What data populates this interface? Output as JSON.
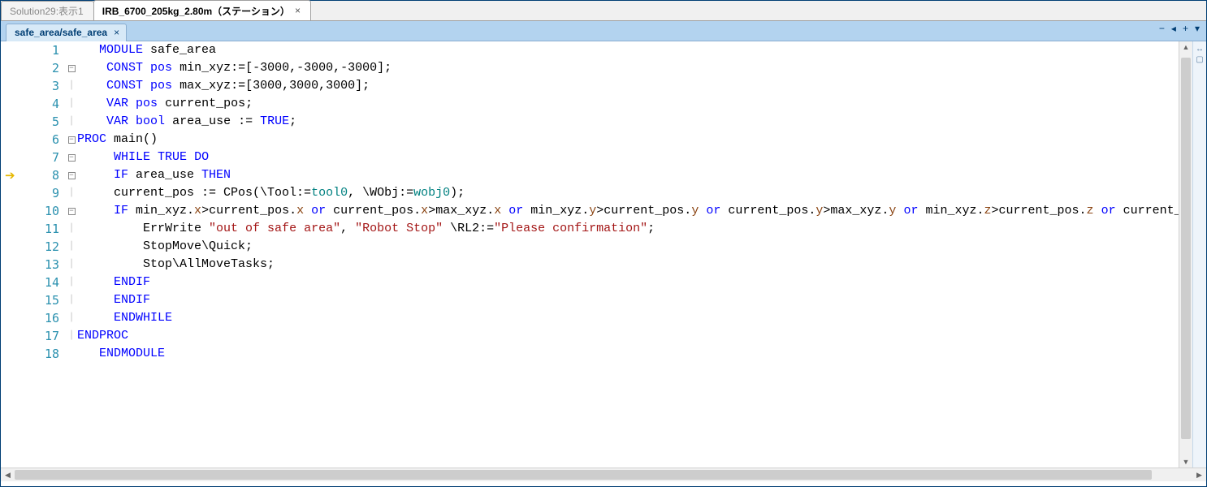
{
  "outerTabs": [
    {
      "label": "Solution29:表示1",
      "active": false,
      "closable": false
    },
    {
      "label": "IRB_6700_205kg_2.80m（ステーション）",
      "active": true,
      "closable": true
    }
  ],
  "innerTab": {
    "label": "safe_area/safe_area",
    "closeGlyph": "×"
  },
  "toolbarIcons": {
    "minimize": "−",
    "zoomOut": "◂",
    "zoomIn": "+",
    "menu": "▾"
  },
  "execArrowLine": 8,
  "code": {
    "lines": [
      {
        "n": 1,
        "fold": "",
        "tokens": [
          [
            "",
            "   "
          ],
          [
            "kw",
            "MODULE"
          ],
          [
            "",
            " safe_area"
          ]
        ]
      },
      {
        "n": 2,
        "fold": "-",
        "tokens": [
          [
            "",
            "    "
          ],
          [
            "kw",
            "CONST"
          ],
          [
            "",
            " "
          ],
          [
            "type",
            "pos"
          ],
          [
            "",
            " min_xyz:=[-3000,-3000,-3000];"
          ]
        ]
      },
      {
        "n": 3,
        "fold": "|",
        "tokens": [
          [
            "",
            "    "
          ],
          [
            "kw",
            "CONST"
          ],
          [
            "",
            " "
          ],
          [
            "type",
            "pos"
          ],
          [
            "",
            " max_xyz:=[3000,3000,3000];"
          ]
        ]
      },
      {
        "n": 4,
        "fold": "|",
        "tokens": [
          [
            "",
            "    "
          ],
          [
            "kw",
            "VAR"
          ],
          [
            "",
            " "
          ],
          [
            "type",
            "pos"
          ],
          [
            "",
            " current_pos;"
          ]
        ]
      },
      {
        "n": 5,
        "fold": "|",
        "tokens": [
          [
            "",
            "    "
          ],
          [
            "kw",
            "VAR"
          ],
          [
            "",
            " "
          ],
          [
            "type",
            "bool"
          ],
          [
            "",
            " area_use := "
          ],
          [
            "kw",
            "TRUE"
          ],
          [
            "",
            ";"
          ]
        ]
      },
      {
        "n": 6,
        "fold": "-",
        "tokens": [
          [
            "kw",
            "PROC"
          ],
          [
            "",
            " main()"
          ]
        ]
      },
      {
        "n": 7,
        "fold": "-",
        "tokens": [
          [
            "",
            "     "
          ],
          [
            "kw",
            "WHILE"
          ],
          [
            "",
            " "
          ],
          [
            "kw",
            "TRUE"
          ],
          [
            "",
            " "
          ],
          [
            "kw",
            "DO"
          ]
        ]
      },
      {
        "n": 8,
        "fold": "-",
        "tokens": [
          [
            "",
            "     "
          ],
          [
            "kw",
            "IF"
          ],
          [
            "",
            " area_use "
          ],
          [
            "kw",
            "THEN"
          ]
        ]
      },
      {
        "n": 9,
        "fold": "|",
        "tokens": [
          [
            "",
            "     current_pos := "
          ],
          [
            "fn",
            "CPos"
          ],
          [
            "",
            "(\\Tool:="
          ],
          [
            "builtin",
            "tool0"
          ],
          [
            "",
            ", \\WObj:="
          ],
          [
            "builtin",
            "wobj0"
          ],
          [
            "",
            ");"
          ]
        ]
      },
      {
        "n": 10,
        "fold": "-",
        "tokens": [
          [
            "",
            "     "
          ],
          [
            "kw",
            "IF"
          ],
          [
            "",
            " min_xyz."
          ],
          [
            "brown",
            "x"
          ],
          [
            "",
            ">current_pos."
          ],
          [
            "brown",
            "x"
          ],
          [
            "",
            " "
          ],
          [
            "kw",
            "or"
          ],
          [
            "",
            " current_pos."
          ],
          [
            "brown",
            "x"
          ],
          [
            "",
            ">max_xyz."
          ],
          [
            "brown",
            "x"
          ],
          [
            "",
            " "
          ],
          [
            "kw",
            "or"
          ],
          [
            "",
            " min_xyz."
          ],
          [
            "brown",
            "y"
          ],
          [
            "",
            ">current_pos."
          ],
          [
            "brown",
            "y"
          ],
          [
            "",
            " "
          ],
          [
            "kw",
            "or"
          ],
          [
            "",
            " current_pos."
          ],
          [
            "brown",
            "y"
          ],
          [
            "",
            ">max_xyz."
          ],
          [
            "brown",
            "y"
          ],
          [
            "",
            " "
          ],
          [
            "kw",
            "or"
          ],
          [
            "",
            " min_xyz."
          ],
          [
            "brown",
            "z"
          ],
          [
            "",
            ">current_pos."
          ],
          [
            "brown",
            "z"
          ],
          [
            "",
            " "
          ],
          [
            "kw",
            "or"
          ],
          [
            "",
            " current_po"
          ]
        ]
      },
      {
        "n": 11,
        "fold": "|",
        "tokens": [
          [
            "",
            "         "
          ],
          [
            "fn",
            "ErrWrite"
          ],
          [
            "",
            " "
          ],
          [
            "str",
            "\"out of safe area\""
          ],
          [
            "",
            ", "
          ],
          [
            "str",
            "\"Robot Stop\""
          ],
          [
            "",
            " \\RL2:="
          ],
          [
            "str",
            "\"Please confirmation\""
          ],
          [
            "",
            ";"
          ]
        ]
      },
      {
        "n": 12,
        "fold": "|",
        "tokens": [
          [
            "",
            "         "
          ],
          [
            "fn",
            "StopMove"
          ],
          [
            "",
            "\\Quick;"
          ]
        ]
      },
      {
        "n": 13,
        "fold": "|",
        "tokens": [
          [
            "",
            "         "
          ],
          [
            "fn",
            "Stop"
          ],
          [
            "",
            "\\AllMoveTasks;"
          ]
        ]
      },
      {
        "n": 14,
        "fold": "|",
        "tokens": [
          [
            "",
            "     "
          ],
          [
            "kw",
            "ENDIF"
          ]
        ]
      },
      {
        "n": 15,
        "fold": "|",
        "tokens": [
          [
            "",
            "     "
          ],
          [
            "kw",
            "ENDIF"
          ]
        ]
      },
      {
        "n": 16,
        "fold": "|",
        "tokens": [
          [
            "",
            "     "
          ],
          [
            "kw",
            "ENDWHILE"
          ]
        ]
      },
      {
        "n": 17,
        "fold": "|",
        "tokens": [
          [
            "kw",
            "ENDPROC"
          ]
        ]
      },
      {
        "n": 18,
        "fold": "",
        "tokens": [
          [
            "",
            "   "
          ],
          [
            "kw",
            "ENDMODULE"
          ]
        ]
      }
    ]
  }
}
